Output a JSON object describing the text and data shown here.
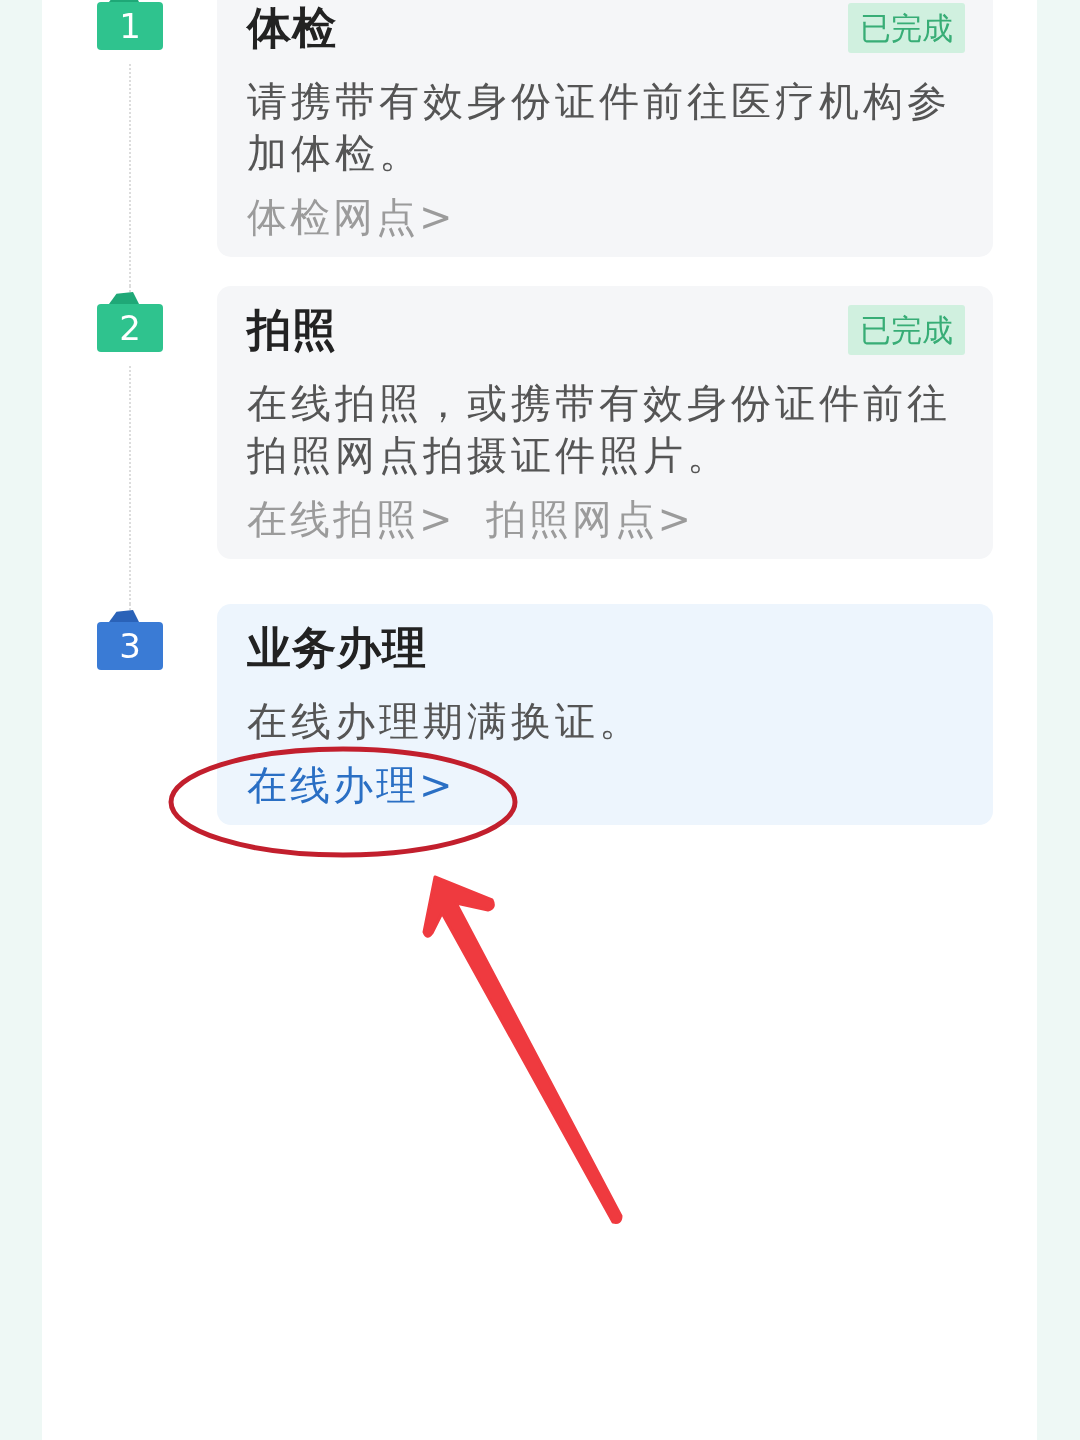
{
  "steps": [
    {
      "number": "1",
      "title": "体检",
      "completed": true,
      "status": "已完成",
      "description": "请携带有效身份证件前往医疗机构参加体检。",
      "links": [
        "体检网点>"
      ]
    },
    {
      "number": "2",
      "title": "拍照",
      "completed": true,
      "status": "已完成",
      "description": "在线拍照，或携带有效身份证件前往拍照网点拍摄证件照片。",
      "links": [
        "在线拍照>",
        "拍照网点>"
      ]
    },
    {
      "number": "3",
      "title": "业务办理",
      "completed": false,
      "description": "在线办理期满换证。",
      "links": [
        "在线办理>"
      ]
    }
  ]
}
